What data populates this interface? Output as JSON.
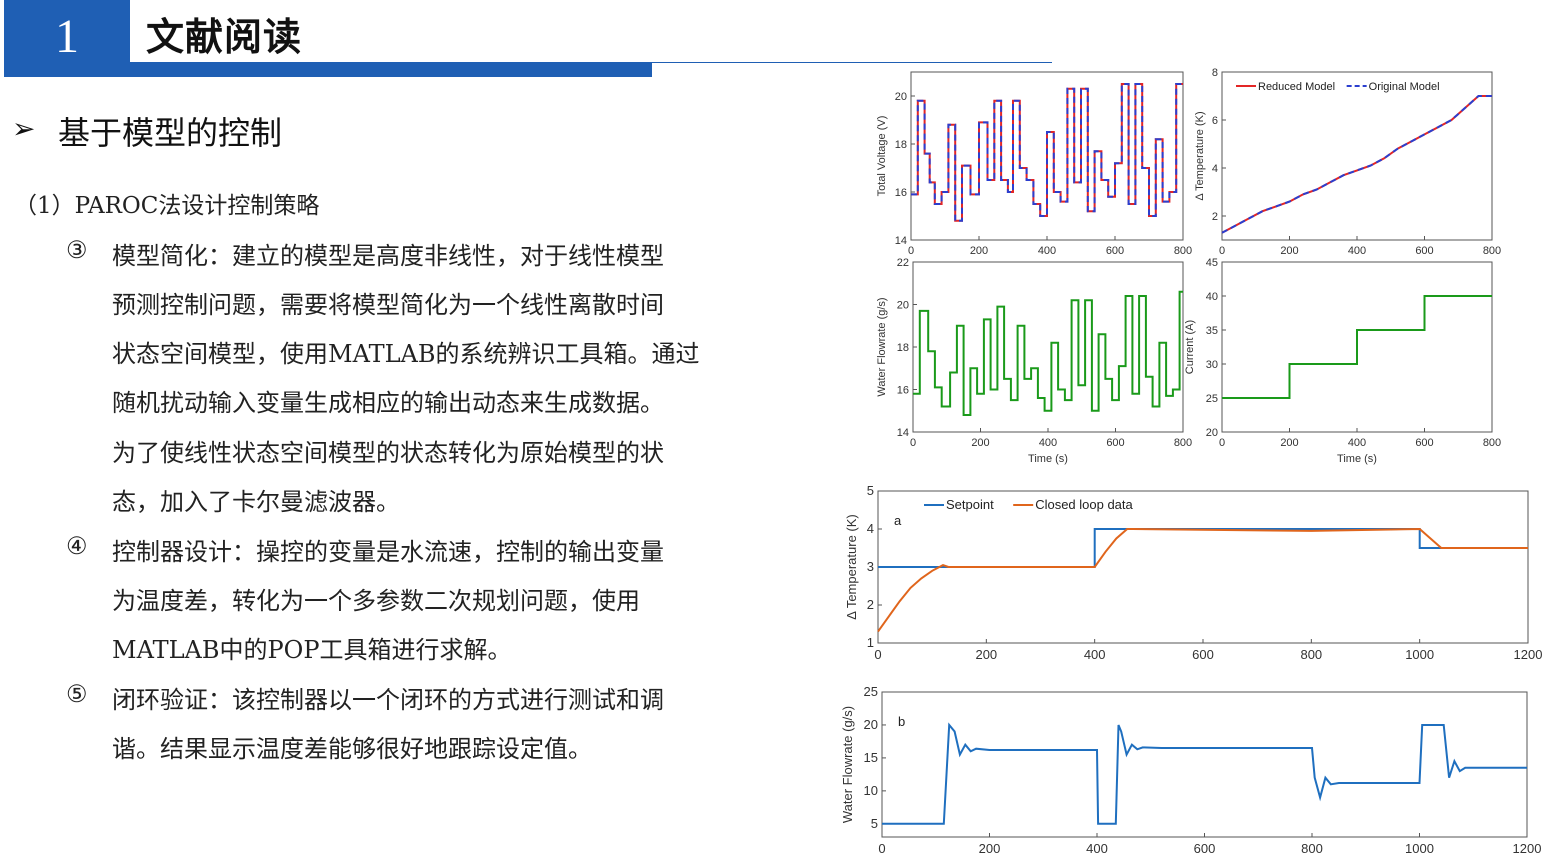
{
  "header": {
    "number": "1",
    "title": "文献阅读"
  },
  "section": {
    "arrow": "➢",
    "title": "基于模型的控制"
  },
  "content": {
    "subheading": "（1）PAROC法设计控制策略",
    "items": [
      {
        "marker": "③",
        "lines": [
          "模型简化：建立的模型是高度非线性，对于线性模型",
          "预测控制问题，需要将模型简化为一个线性离散时间",
          "状态空间模型，使用MATLAB的系统辨识工具箱。通过",
          "随机扰动输入变量生成相应的输出动态来生成数据。",
          "为了使线性状态空间模型的状态转化为原始模型的状",
          "态，加入了卡尔曼滤波器。"
        ]
      },
      {
        "marker": "④",
        "lines": [
          "控制器设计：操控的变量是水流速，控制的输出变量",
          "为温度差，转化为一个多参数二次规划问题，使用",
          "MATLAB中的POP工具箱进行求解。"
        ]
      },
      {
        "marker": "⑤",
        "lines": [
          "闭环验证：该控制器以一个闭环的方式进行测试和调",
          "谐。结果显示温度差能够很好地跟踪设定值。"
        ]
      }
    ]
  },
  "chart_data": [
    {
      "type": "line",
      "ylabel": "Total Voltage (V)",
      "xlabel": "",
      "xlim": [
        0,
        800
      ],
      "ylim": [
        14,
        21
      ],
      "xticks": [
        "0",
        "200",
        "400",
        "600",
        "800"
      ],
      "yticks": [
        "14",
        "16",
        "18",
        "20"
      ],
      "series": [
        {
          "name": "Reduced Model",
          "color": "#e32626",
          "dash": "",
          "x": [
            0,
            20,
            20,
            40,
            40,
            55,
            55,
            70,
            70,
            90,
            90,
            110,
            110,
            130,
            130,
            150,
            150,
            175,
            175,
            200,
            200,
            225,
            225,
            245,
            245,
            265,
            265,
            285,
            285,
            300,
            300,
            320,
            320,
            340,
            340,
            360,
            360,
            380,
            380,
            400,
            400,
            420,
            420,
            440,
            440,
            460,
            460,
            480,
            480,
            500,
            500,
            520,
            520,
            540,
            540,
            560,
            560,
            580,
            580,
            600,
            600,
            620,
            620,
            640,
            640,
            660,
            660,
            680,
            680,
            700,
            700,
            720,
            720,
            740,
            740,
            760,
            760,
            780,
            780,
            800
          ],
          "y": [
            15.9,
            15.9,
            19.8,
            19.8,
            17.6,
            17.6,
            16.4,
            16.4,
            15.5,
            15.5,
            16.0,
            16.0,
            18.8,
            18.8,
            14.8,
            14.8,
            17.1,
            17.1,
            15.9,
            15.9,
            18.9,
            18.9,
            16.5,
            16.5,
            19.8,
            19.8,
            16.5,
            16.5,
            16.0,
            16.0,
            19.8,
            19.8,
            17.0,
            17.0,
            16.5,
            16.5,
            15.5,
            15.5,
            15.0,
            15.0,
            18.5,
            18.5,
            16.0,
            16.0,
            15.6,
            15.6,
            20.3,
            20.3,
            16.4,
            16.4,
            20.3,
            20.3,
            15.2,
            15.2,
            17.7,
            17.7,
            16.5,
            16.5,
            15.8,
            15.8,
            17.2,
            17.2,
            20.5,
            20.5,
            15.5,
            15.5,
            20.5,
            20.5,
            17.0,
            17.0,
            15.0,
            15.0,
            18.2,
            18.2,
            15.6,
            15.6,
            16.0,
            16.0,
            20.5,
            20.5
          ]
        },
        {
          "name": "Original Model",
          "color": "#2b3fcf",
          "dash": "6,4",
          "x": [
            0,
            20,
            20,
            40,
            40,
            55,
            55,
            70,
            70,
            90,
            90,
            110,
            110,
            130,
            130,
            150,
            150,
            175,
            175,
            200,
            200,
            225,
            225,
            245,
            245,
            265,
            265,
            285,
            285,
            300,
            300,
            320,
            320,
            340,
            340,
            360,
            360,
            380,
            380,
            400,
            400,
            420,
            420,
            440,
            440,
            460,
            460,
            480,
            480,
            500,
            500,
            520,
            520,
            540,
            540,
            560,
            560,
            580,
            580,
            600,
            600,
            620,
            620,
            640,
            640,
            660,
            660,
            680,
            680,
            700,
            700,
            720,
            720,
            740,
            740,
            760,
            760,
            780,
            780,
            800
          ],
          "y": [
            15.9,
            15.9,
            19.8,
            19.8,
            17.6,
            17.6,
            16.4,
            16.4,
            15.5,
            15.5,
            16.0,
            16.0,
            18.8,
            18.8,
            14.8,
            14.8,
            17.1,
            17.1,
            15.9,
            15.9,
            18.9,
            18.9,
            16.5,
            16.5,
            19.8,
            19.8,
            16.5,
            16.5,
            16.0,
            16.0,
            19.8,
            19.8,
            17.0,
            17.0,
            16.5,
            16.5,
            15.5,
            15.5,
            15.0,
            15.0,
            18.5,
            18.5,
            16.0,
            16.0,
            15.6,
            15.6,
            20.3,
            20.3,
            16.4,
            16.4,
            20.3,
            20.3,
            15.2,
            15.2,
            17.7,
            17.7,
            16.5,
            16.5,
            15.8,
            15.8,
            17.2,
            17.2,
            20.5,
            20.5,
            15.5,
            15.5,
            20.5,
            20.5,
            17.0,
            17.0,
            15.0,
            15.0,
            18.2,
            18.2,
            15.6,
            15.6,
            16.0,
            16.0,
            20.5,
            20.5
          ]
        }
      ]
    },
    {
      "type": "line",
      "ylabel": "Δ Temperature (K)",
      "xlabel": "",
      "xlim": [
        0,
        800
      ],
      "ylim": [
        1,
        8
      ],
      "xticks": [
        "0",
        "200",
        "400",
        "600",
        "800"
      ],
      "yticks": [
        "2",
        "4",
        "6",
        "8"
      ],
      "legend": "top-left",
      "series": [
        {
          "name": "Reduced Model",
          "color": "#e32626",
          "dash": "",
          "x": [
            0,
            40,
            80,
            120,
            160,
            200,
            240,
            280,
            320,
            360,
            400,
            440,
            480,
            520,
            560,
            600,
            640,
            680,
            720,
            760,
            800
          ],
          "y": [
            1.3,
            1.6,
            1.9,
            2.2,
            2.4,
            2.6,
            2.9,
            3.1,
            3.4,
            3.7,
            3.9,
            4.1,
            4.4,
            4.8,
            5.1,
            5.4,
            5.7,
            6.0,
            6.5,
            7.0,
            7.0
          ]
        },
        {
          "name": "Original Model",
          "color": "#2b3fcf",
          "dash": "6,4",
          "x": [
            0,
            40,
            80,
            120,
            160,
            200,
            240,
            280,
            320,
            360,
            400,
            440,
            480,
            520,
            560,
            600,
            640,
            680,
            720,
            760,
            800
          ],
          "y": [
            1.3,
            1.6,
            1.9,
            2.2,
            2.4,
            2.6,
            2.9,
            3.1,
            3.4,
            3.7,
            3.9,
            4.1,
            4.4,
            4.8,
            5.1,
            5.4,
            5.7,
            6.0,
            6.5,
            7.0,
            7.0
          ]
        }
      ]
    },
    {
      "type": "line",
      "ylabel": "Water Flowrate (g/s)",
      "xlabel": "Time (s)",
      "xlim": [
        0,
        800
      ],
      "ylim": [
        14,
        22
      ],
      "xticks": [
        "0",
        "200",
        "400",
        "600",
        "800"
      ],
      "yticks": [
        "14",
        "16",
        "18",
        "20",
        "22"
      ],
      "series": [
        {
          "name": "",
          "color": "#1a9a1a",
          "dash": "",
          "x": [
            0,
            20,
            20,
            45,
            45,
            65,
            65,
            85,
            85,
            110,
            110,
            130,
            130,
            150,
            150,
            170,
            170,
            190,
            190,
            210,
            210,
            230,
            230,
            250,
            250,
            270,
            270,
            290,
            290,
            310,
            310,
            330,
            330,
            350,
            350,
            370,
            370,
            390,
            390,
            410,
            410,
            430,
            430,
            450,
            450,
            470,
            470,
            490,
            490,
            510,
            510,
            530,
            530,
            550,
            550,
            570,
            570,
            590,
            590,
            610,
            610,
            630,
            630,
            650,
            650,
            670,
            670,
            690,
            690,
            710,
            710,
            730,
            730,
            750,
            750,
            770,
            770,
            790,
            790,
            800
          ],
          "y": [
            15.8,
            15.8,
            19.7,
            19.7,
            17.8,
            17.8,
            16.1,
            16.1,
            15.2,
            15.2,
            16.8,
            16.8,
            19.0,
            19.0,
            14.8,
            14.8,
            17.0,
            17.0,
            15.8,
            15.8,
            19.3,
            19.3,
            16.0,
            16.0,
            19.9,
            19.9,
            16.5,
            16.5,
            15.5,
            15.5,
            19.0,
            19.0,
            16.5,
            16.5,
            17.0,
            17.0,
            15.6,
            15.6,
            15.0,
            15.0,
            18.2,
            18.2,
            16.0,
            16.0,
            15.5,
            15.5,
            20.2,
            20.2,
            16.2,
            16.2,
            20.2,
            20.2,
            15.0,
            15.0,
            18.6,
            18.6,
            16.5,
            16.5,
            15.5,
            15.5,
            17.1,
            17.1,
            20.4,
            20.4,
            15.8,
            15.8,
            20.4,
            20.4,
            16.6,
            16.6,
            15.2,
            15.2,
            18.2,
            18.2,
            15.7,
            15.7,
            16.0,
            16.0,
            20.6,
            20.6
          ]
        }
      ]
    },
    {
      "type": "line",
      "ylabel": "Current (A)",
      "xlabel": "Time (s)",
      "xlim": [
        0,
        800
      ],
      "ylim": [
        20,
        45
      ],
      "xticks": [
        "0",
        "200",
        "400",
        "600",
        "800"
      ],
      "yticks": [
        "20",
        "25",
        "30",
        "35",
        "40",
        "45"
      ],
      "series": [
        {
          "name": "",
          "color": "#1a9a1a",
          "dash": "",
          "x": [
            0,
            200,
            200,
            400,
            400,
            600,
            600,
            800
          ],
          "y": [
            25,
            25,
            30,
            30,
            35,
            35,
            40,
            40
          ]
        }
      ]
    },
    {
      "type": "line",
      "ylabel": "Δ Temperature (K)",
      "xlabel": "",
      "annotation": "a",
      "xlim": [
        0,
        1200
      ],
      "ylim": [
        1,
        5
      ],
      "xticks": [
        "0",
        "200",
        "400",
        "600",
        "800",
        "1000",
        "1200"
      ],
      "yticks": [
        "1",
        "2",
        "3",
        "4",
        "5"
      ],
      "legend": "top-left",
      "series": [
        {
          "name": "Setpoint",
          "color": "#1f6fbf",
          "dash": "",
          "x": [
            0,
            400,
            400,
            1000,
            1000,
            1200
          ],
          "y": [
            3,
            3,
            4,
            4,
            3.5,
            3.5
          ]
        },
        {
          "name": "Closed loop data",
          "color": "#e0651c",
          "dash": "",
          "x": [
            0,
            20,
            40,
            60,
            80,
            100,
            120,
            130,
            200,
            400,
            420,
            440,
            460,
            470,
            800,
            1000,
            1020,
            1040,
            1050,
            1200
          ],
          "y": [
            1.3,
            1.7,
            2.1,
            2.45,
            2.7,
            2.9,
            3.05,
            3.0,
            3.0,
            3.0,
            3.4,
            3.75,
            4.0,
            4.0,
            3.95,
            4.0,
            3.75,
            3.5,
            3.5,
            3.5
          ]
        }
      ]
    },
    {
      "type": "line",
      "ylabel": "Water Flowrate (g/s)",
      "xlabel": "",
      "annotation": "b",
      "xlim": [
        0,
        1200
      ],
      "ylim": [
        3,
        25
      ],
      "xticks": [
        "0",
        "200",
        "400",
        "600",
        "800",
        "1000",
        "1200"
      ],
      "yticks": [
        "5",
        "10",
        "15",
        "20",
        "25"
      ],
      "series": [
        {
          "name": "",
          "color": "#1f6fbf",
          "dash": "",
          "x": [
            0,
            115,
            125,
            135,
            145,
            155,
            165,
            175,
            200,
            400,
            402,
            405,
            435,
            440,
            445,
            455,
            465,
            475,
            485,
            520,
            800,
            805,
            815,
            825,
            835,
            850,
            1000,
            1005,
            1045,
            1050,
            1055,
            1065,
            1075,
            1085,
            1200
          ],
          "y": [
            5,
            5,
            20,
            19,
            15.5,
            17,
            16,
            16.4,
            16.2,
            16.2,
            5,
            5,
            5,
            20,
            19,
            15.5,
            17,
            16.3,
            16.6,
            16.5,
            16.5,
            12,
            9,
            12,
            11,
            11.2,
            11.2,
            20,
            20,
            16,
            12,
            14.5,
            13,
            13.5,
            13.5
          ]
        }
      ]
    }
  ]
}
